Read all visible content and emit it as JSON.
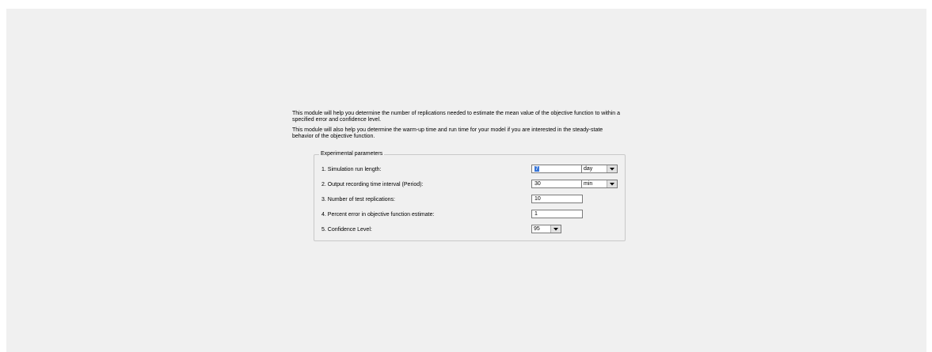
{
  "intro": {
    "paragraph1": "This module will help you determine the number of replications needed to estimate the mean value of the objective function to within a specified error and confidence level.",
    "paragraph2": "This module will also help you determine the warm-up time and run time for your model if you are interested in the steady-state behavior of the objective function."
  },
  "group": {
    "title": "Experimental parameters"
  },
  "params": {
    "run_length": {
      "label": "1. Simulation run length:",
      "value": "7",
      "unit": "day"
    },
    "interval": {
      "label": "2. Output recording time interval (Period):",
      "value": "30",
      "unit": "min"
    },
    "replications": {
      "label": "3. Number of test replications:",
      "value": "10"
    },
    "percent_error": {
      "label": "4. Percent error in objective function estimate:",
      "value": "1"
    },
    "confidence": {
      "label": "5. Confidence Level:",
      "value": "95"
    }
  },
  "icons": {
    "dropdown": "chevron-down-icon"
  }
}
